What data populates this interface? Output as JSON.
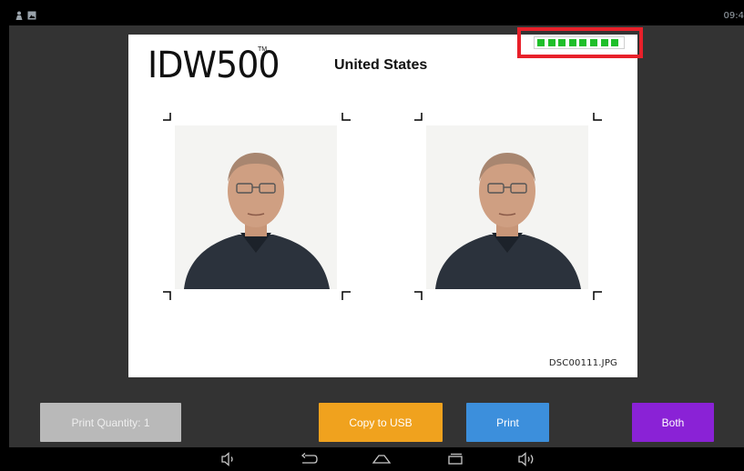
{
  "status_bar": {
    "time": "09:4",
    "icons": [
      "person-notification-icon",
      "image-notification-icon"
    ]
  },
  "preview": {
    "logo": "IDW500",
    "logo_tm": "TM",
    "country": "United States",
    "file_name": "DSC00111.JPG",
    "photos": [
      "passport-photo",
      "passport-photo"
    ]
  },
  "quality_indicator": {
    "segments_filled": 8,
    "segments_total": 8,
    "color": "#1fbf2a",
    "highlight_color": "#e8202a"
  },
  "buttons": {
    "quantity": "Print Quantity: 1",
    "copy_usb": "Copy to USB",
    "print": "Print",
    "both": "Both"
  },
  "colors": {
    "quantity_bg": "#b9b9b9",
    "copy_usb_bg": "#f0a21e",
    "print_bg": "#3c8fdc",
    "both_bg": "#8a22d6",
    "background": "#333333"
  },
  "nav_bar": {
    "icons": [
      "volume-down-icon",
      "back-icon",
      "home-icon",
      "recent-apps-icon",
      "volume-up-icon"
    ]
  }
}
